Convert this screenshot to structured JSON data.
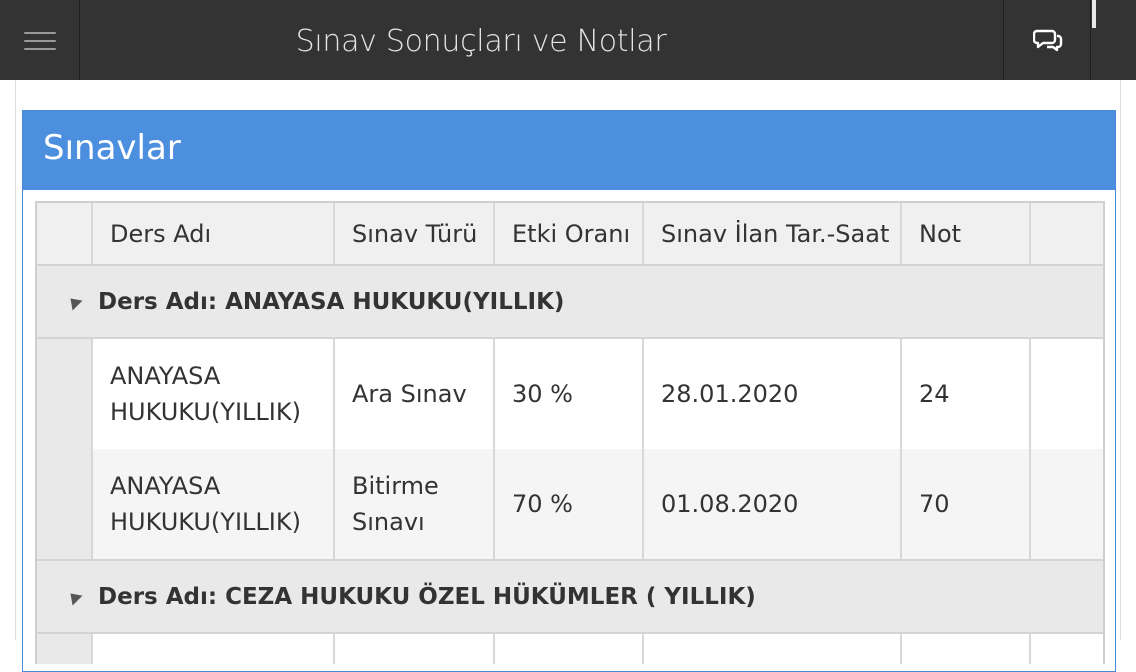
{
  "header": {
    "title": "Sınav Sonuçları ve Notlar",
    "menu_icon": "hamburger-menu-icon",
    "chat_icon": "chat-bubbles-icon"
  },
  "panel": {
    "title": "Sınavlar"
  },
  "table": {
    "columns": [
      "Ders Adı",
      "Sınav Türü",
      "Etki Oranı",
      "Sınav İlan Tar.-Saat",
      "Not"
    ],
    "groups": [
      {
        "label": "Ders Adı: ANAYASA HUKUKU(YILLIK)",
        "rows": [
          {
            "course": "ANAYASA HUKUKU(YILLIK)",
            "type": "Ara Sınav",
            "weight": "30 %",
            "date": "28.01.2020",
            "grade": "24"
          },
          {
            "course": "ANAYASA HUKUKU(YILLIK)",
            "type": "Bitirme Sınavı",
            "weight": "70 %",
            "date": "01.08.2020",
            "grade": "70"
          }
        ]
      },
      {
        "label": "Ders Adı: CEZA HUKUKU ÖZEL HÜKÜMLER ( YILLIK)",
        "rows": []
      }
    ]
  },
  "colors": {
    "topbar": "#333333",
    "panel_header": "#4d8fdf"
  }
}
